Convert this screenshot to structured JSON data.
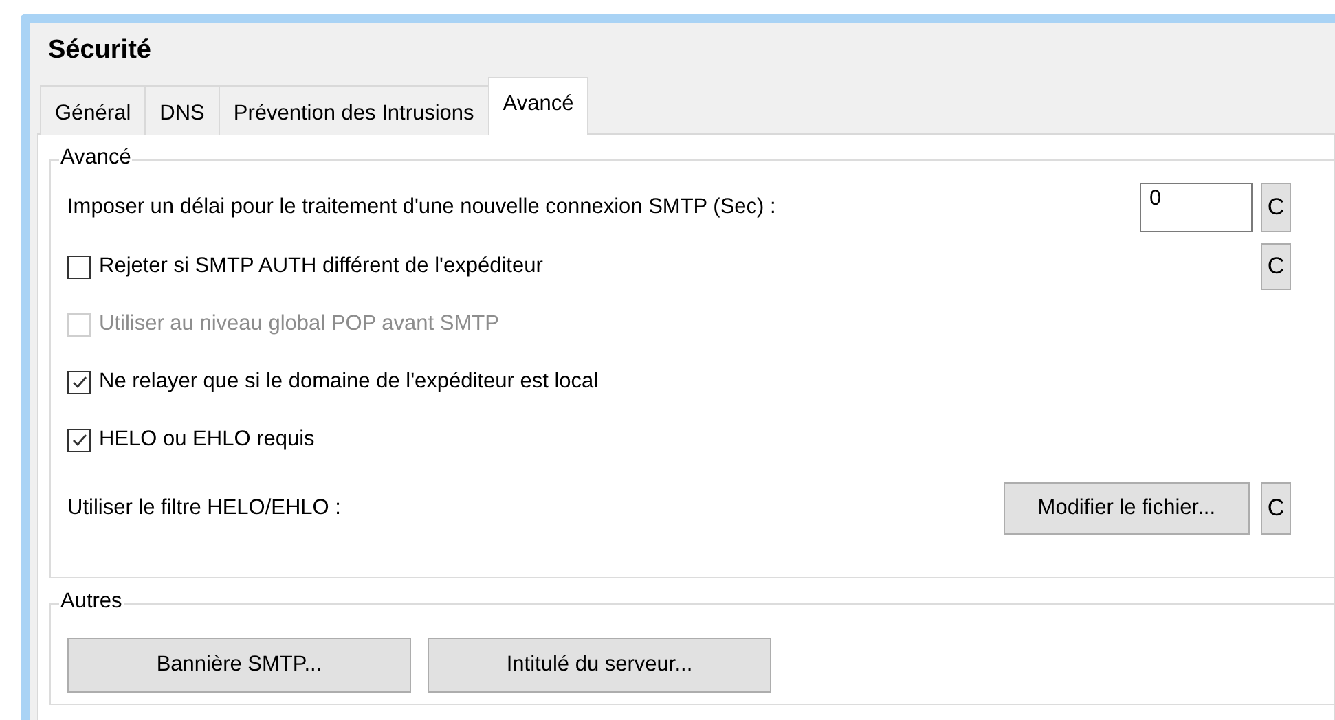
{
  "window": {
    "title": "Sécurité"
  },
  "tabs": [
    {
      "label": "Général",
      "selected": false
    },
    {
      "label": "DNS",
      "selected": false
    },
    {
      "label": "Prévention des Intrusions",
      "selected": false
    },
    {
      "label": "Avancé",
      "selected": true
    }
  ],
  "groups": [
    {
      "title": "Avancé",
      "rows": [
        {
          "kind": "number",
          "label": "Imposer un délai pour le traitement d'une nouvelle connexion SMTP (Sec) :",
          "value": "0",
          "reset": "C"
        },
        {
          "kind": "checkbox",
          "label": "Rejeter si SMTP AUTH différent de l'expéditeur",
          "checked": false,
          "disabled": false,
          "reset": "C"
        },
        {
          "kind": "checkbox",
          "label": "Utiliser au niveau global POP avant SMTP",
          "checked": false,
          "disabled": true
        },
        {
          "kind": "checkbox",
          "label": "Ne relayer que si le domaine de l'expéditeur est local",
          "checked": true,
          "disabled": false
        },
        {
          "kind": "checkbox",
          "label": "HELO ou EHLO requis",
          "checked": true,
          "disabled": false
        },
        {
          "kind": "file",
          "label": "Utiliser le filtre HELO/EHLO :",
          "button": "Modifier le fichier...",
          "reset": "C"
        }
      ]
    },
    {
      "title": "Autres",
      "buttons": [
        "Bannière SMTP...",
        "Intitulé du serveur..."
      ]
    }
  ]
}
